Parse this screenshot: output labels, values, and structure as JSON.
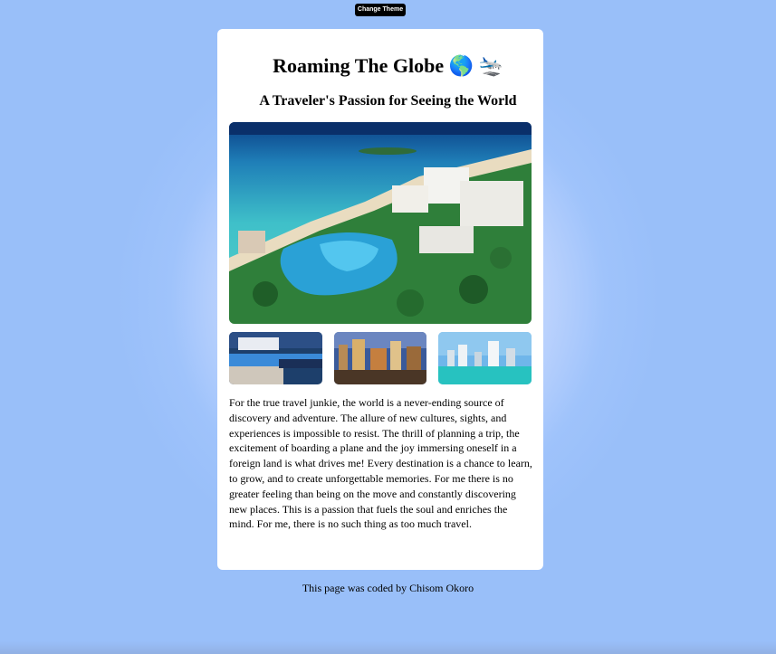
{
  "theme_button": {
    "label": "Change Theme"
  },
  "header": {
    "title": "Roaming The Globe 🌎 🛬",
    "subtitle": "A Traveler's Passion for Seeing the World"
  },
  "images": {
    "hero": "tropical-resort-aerial-photo",
    "thumbnails": [
      "infinity-pool-villa-photo",
      "city-skyline-night-photo",
      "waterfront-skyline-photo"
    ]
  },
  "body_text": "For the true travel junkie, the world is a never-ending source of discovery and adventure. The allure of new cultures, sights, and experiences is impossible to resist. The thrill of planning a trip, the excitement of boarding a plane and the joy immersing oneself in a foreign land is what drives me! Every destination is a chance to learn, to grow, and to create unforgettable memories. For me there is no greater feeling than being on the move and constantly discovering new places. This is a passion that fuels the soul and enriches the mind. For me, there is no such thing as too much travel.",
  "footer": {
    "credit": "This page was coded by Chisom Okoro"
  },
  "colors": {
    "background": "#9cc1fa",
    "card": "#ffffff",
    "button": "#000000",
    "button_text": "#ffffff"
  }
}
